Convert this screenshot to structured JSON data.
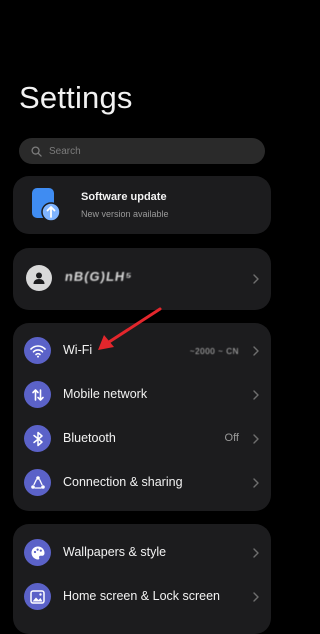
{
  "page": {
    "title": "Settings"
  },
  "search": {
    "placeholder": "Search"
  },
  "software_update": {
    "title": "Software update",
    "subtitle": "New version available"
  },
  "account": {
    "name": "nB(G)LH⁵"
  },
  "connections": {
    "items": [
      {
        "label": "Wi-Fi",
        "value": "~2000 ~ CN",
        "icon": "wifi-icon"
      },
      {
        "label": "Mobile network",
        "value": "",
        "icon": "mobile-data-icon"
      },
      {
        "label": "Bluetooth",
        "value": "Off",
        "icon": "bluetooth-icon"
      },
      {
        "label": "Connection & sharing",
        "value": "",
        "icon": "connection-sharing-icon"
      }
    ]
  },
  "display": {
    "items": [
      {
        "label": "Wallpapers & style",
        "icon": "palette-icon"
      },
      {
        "label": "Home screen & Lock screen",
        "icon": "image-icon"
      }
    ]
  },
  "colors": {
    "background": "#000000",
    "card": "#1c1c1e",
    "icon_accent": "#5b62c8",
    "update_icon": "#3f8cf2",
    "annotation_arrow": "#e3262c"
  }
}
